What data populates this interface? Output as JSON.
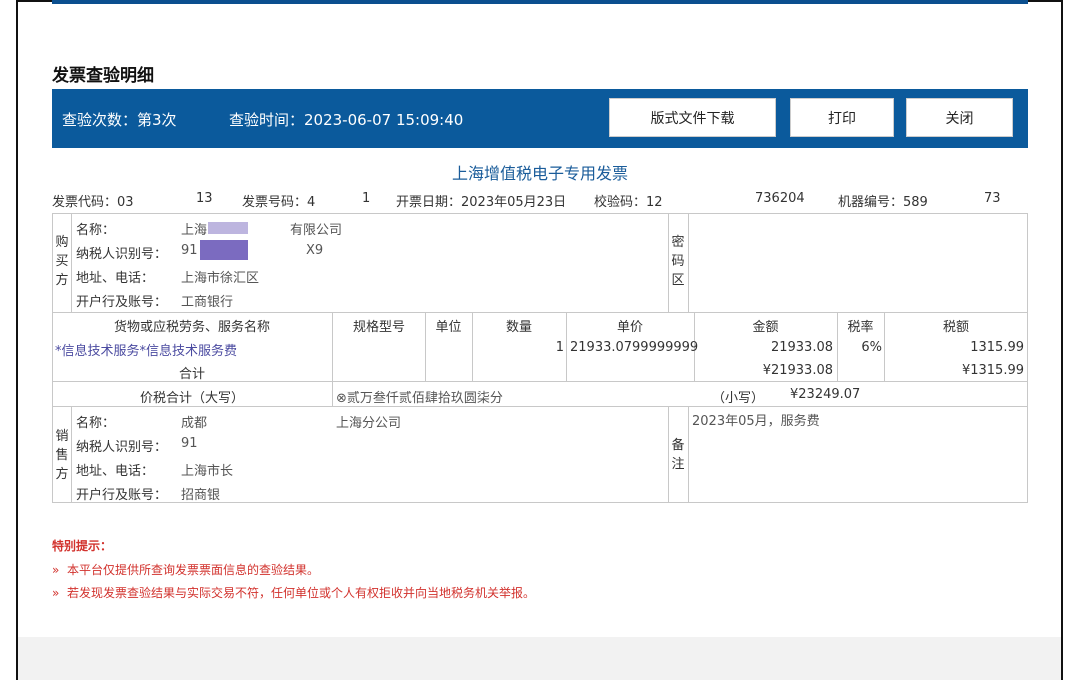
{
  "page_title": "发票查验明细",
  "header": {
    "check_count": "查验次数：第3次",
    "check_time": "查验时间：2023-06-07 15:09:40",
    "download_btn": "版式文件下载",
    "print_btn": "打印",
    "close_btn": "关闭"
  },
  "invoice_title": "上海增值税电子专用发票",
  "info": {
    "code": "发票代码：03",
    "code_tail": "13",
    "number": "发票号码：4",
    "number_tail": "1",
    "date": "开票日期：2023年05月23日",
    "check_code": "校验码：12",
    "check_code_tail": "736204",
    "machine": "机器编号：589",
    "machine_tail": "73"
  },
  "buyer": {
    "section": "购买方",
    "name_label": "名称：",
    "name": "上海",
    "name_tail": "有限公司",
    "tax_label": "纳税人识别号：",
    "tax": "91",
    "tax_tail": "X9",
    "addr_label": "地址、电话：",
    "addr": "上海市徐汇区",
    "bank_label": "开户行及账号：",
    "bank": "工商银行"
  },
  "password_area": "密码区",
  "items": {
    "headers": [
      "货物或应税劳务、服务名称",
      "规格型号",
      "单位",
      "数量",
      "单价",
      "金额",
      "税率",
      "税额"
    ],
    "rows": [
      {
        "name": "*信息技术服务*信息技术服务费",
        "spec": "",
        "unit": "",
        "qty": "1",
        "price": "21933.0799999999",
        "amount": "21933.08",
        "rate": "6%",
        "tax": "1315.99"
      }
    ],
    "total_label": "合计",
    "total_amount": "¥21933.08",
    "total_tax": "¥1315.99"
  },
  "grand_total": {
    "label": "价税合计（大写）",
    "upper": "⊗贰万叁仟贰佰肆拾玖圆柒分",
    "lower_label": "（小写）",
    "lower": "¥23249.07"
  },
  "seller": {
    "section": "销售方",
    "name_label": "名称：",
    "name": "成都",
    "name_tail": "上海分公司",
    "tax_label": "纳税人识别号：",
    "tax": "91",
    "addr_label": "地址、电话：",
    "addr": "上海市长",
    "bank_label": "开户行及账号：",
    "bank": "招商银"
  },
  "remarks": {
    "label": "备注",
    "text": "2023年05月，服务费"
  },
  "notice": {
    "title": "特别提示：",
    "items": [
      "本平台仅提供所查询发票票面信息的查验结果。",
      "若发现发票查验结果与实际交易不符，任何单位或个人有权拒收并向当地税务机关举报。"
    ]
  }
}
